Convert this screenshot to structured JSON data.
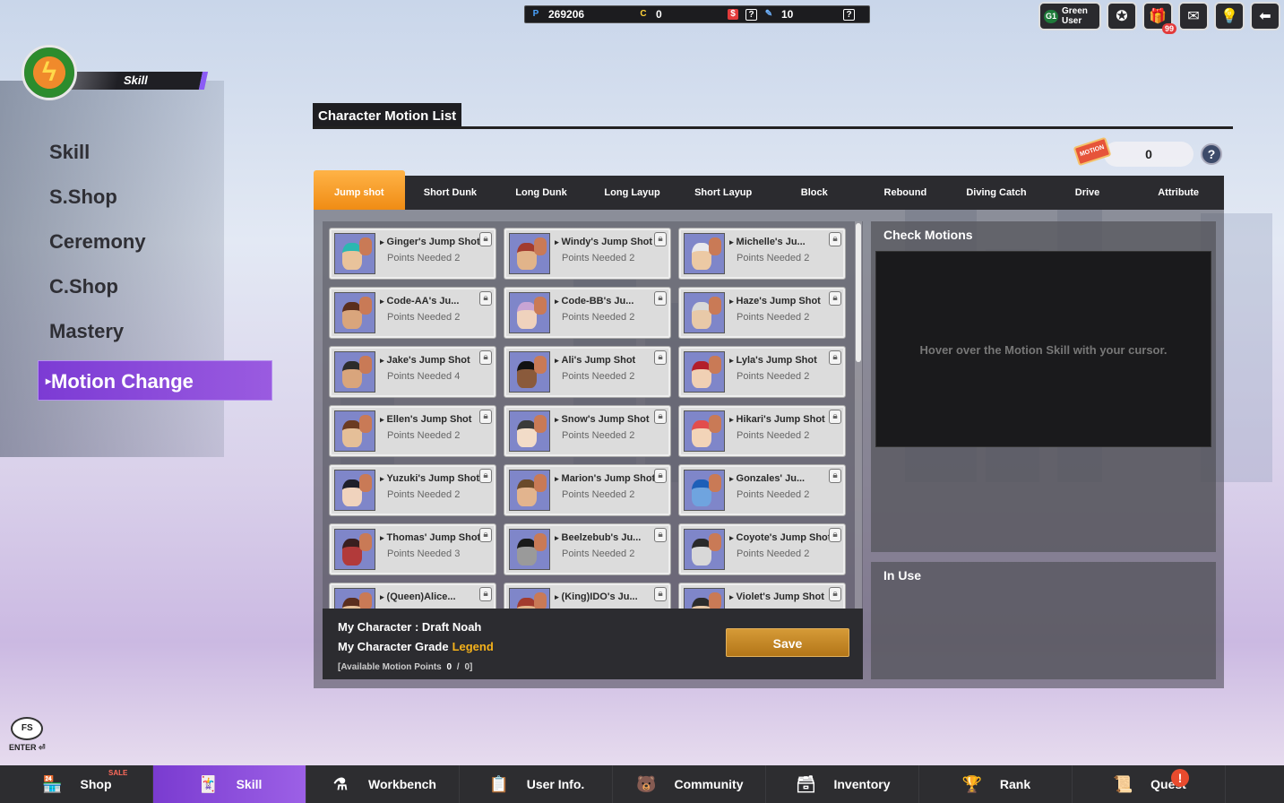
{
  "currency": {
    "points_icon": "P",
    "points": "269206",
    "cash_icon": "C",
    "cash": "0",
    "dollar_icon": "$",
    "tickets": "10"
  },
  "user": {
    "grade": "G1",
    "name_line1": "Green",
    "name_line2": "User"
  },
  "top_buttons": {
    "gift_badge": "99"
  },
  "emblem": {
    "label": "Skill"
  },
  "left_menu": [
    "Skill",
    "S.Shop",
    "Ceremony",
    "C.Shop",
    "Mastery"
  ],
  "left_menu_active": "Motion Change",
  "title": "Character Motion List",
  "ticket": {
    "label": "MOTION",
    "count": "0",
    "help": "?"
  },
  "tabs": [
    "Jump shot",
    "Short Dunk",
    "Long Dunk",
    "Long Layup",
    "Short Layup",
    "Block",
    "Rebound",
    "Diving Catch",
    "Drive",
    "Attribute"
  ],
  "active_tab": 0,
  "motions": [
    {
      "name": "Ginger's Jump Shot",
      "points": "Points Needed 2",
      "hair": "#2bb8b0",
      "skin": "#e9c39b"
    },
    {
      "name": "Windy's Jump Shot",
      "points": "Points Needed 2",
      "hair": "#a23b2e",
      "skin": "#e1b48a"
    },
    {
      "name": "Michelle's Ju...",
      "points": "Points Needed 2",
      "hair": "#e8e8ec",
      "skin": "#ecc9a4"
    },
    {
      "name": "Code-AA's Ju...",
      "points": "Points Needed 2",
      "hair": "#5a2e1e",
      "skin": "#d9a57c"
    },
    {
      "name": "Code-BB's Ju...",
      "points": "Points Needed 2",
      "hair": "#c8a4d4",
      "skin": "#efd2bd"
    },
    {
      "name": "Haze's Jump Shot",
      "points": "Points Needed 2",
      "hair": "#d8d8d8",
      "skin": "#e8c9a8"
    },
    {
      "name": "Jake's Jump Shot",
      "points": "Points Needed 4",
      "hair": "#2c2c2c",
      "skin": "#d9a57c"
    },
    {
      "name": "Ali's Jump Shot",
      "points": "Points Needed 2",
      "hair": "#111111",
      "skin": "#8a5a3b"
    },
    {
      "name": "Lyla's Jump Shot",
      "points": "Points Needed 2",
      "hair": "#b31e2b",
      "skin": "#f0d0b4"
    },
    {
      "name": "Ellen's Jump Shot",
      "points": "Points Needed 2",
      "hair": "#6b3b22",
      "skin": "#e5bf98"
    },
    {
      "name": "Snow's Jump Shot",
      "points": "Points Needed 2",
      "hair": "#3a3a3a",
      "skin": "#f2dcc8"
    },
    {
      "name": "Hikari's Jump Shot",
      "points": "Points Needed 2",
      "hair": "#e24d4d",
      "skin": "#f2d4b8"
    },
    {
      "name": "Yuzuki's Jump Shot",
      "points": "Points Needed 2",
      "hair": "#1f1f2a",
      "skin": "#f0d3bd"
    },
    {
      "name": "Marion's Jump Shot",
      "points": "Points Needed 2",
      "hair": "#6a4a2a",
      "skin": "#e2b48e"
    },
    {
      "name": "Gonzales' Ju...",
      "points": "Points Needed 2",
      "hair": "#1d5fb8",
      "skin": "#6fa4df"
    },
    {
      "name": "Thomas' Jump Shot",
      "points": "Points Needed 3",
      "hair": "#3a1f1f",
      "skin": "#b23a3a"
    },
    {
      "name": "Beelzebub's Ju...",
      "points": "Points Needed 2",
      "hair": "#1a1a1a",
      "skin": "#9a9a9a"
    },
    {
      "name": "Coyote's Jump Shot",
      "points": "Points Needed 2",
      "hair": "#2a2a2a",
      "skin": "#d8d8d8"
    },
    {
      "name": "(Queen)Alice...",
      "points": "",
      "hair": "#5a2e1e",
      "skin": "#e5bf98"
    },
    {
      "name": "(King)IDO's Ju...",
      "points": "",
      "hair": "#a23b2e",
      "skin": "#e1b48a"
    },
    {
      "name": "Violet's Jump Shot",
      "points": "",
      "hair": "#2c2c2c",
      "skin": "#e8c9a8"
    }
  ],
  "footer": {
    "my_character": "My Character : Draft Noah",
    "grade_label": "My Character Grade",
    "grade_value": "Legend",
    "motion_points_prefix": "[Available Motion Points",
    "motion_points_used": "0",
    "motion_points_sep": "/",
    "motion_points_total": "0]",
    "save": "Save"
  },
  "check_motions": {
    "title": "Check Motions",
    "hint": "Hover over the Motion Skill with your cursor."
  },
  "in_use": {
    "title": "In Use"
  },
  "fs": {
    "logo": "FS",
    "enter": "ENTER"
  },
  "bottom_nav": [
    {
      "label": "Shop",
      "icon": "🏪",
      "name": "shop"
    },
    {
      "label": "Skill",
      "icon": "🃏",
      "name": "skill"
    },
    {
      "label": "Workbench",
      "icon": "⚗",
      "name": "workbench"
    },
    {
      "label": "User Info.",
      "icon": "📋",
      "name": "user-info"
    },
    {
      "label": "Community",
      "icon": "🐻",
      "name": "community"
    },
    {
      "label": "Inventory",
      "icon": "🗃",
      "name": "inventory"
    },
    {
      "label": "Rank",
      "icon": "🏆",
      "name": "rank"
    },
    {
      "label": "Quest",
      "icon": "📜",
      "name": "quest"
    }
  ],
  "bottom_nav_active": 1,
  "shop_sale": "SALE",
  "quest_alert": "!"
}
